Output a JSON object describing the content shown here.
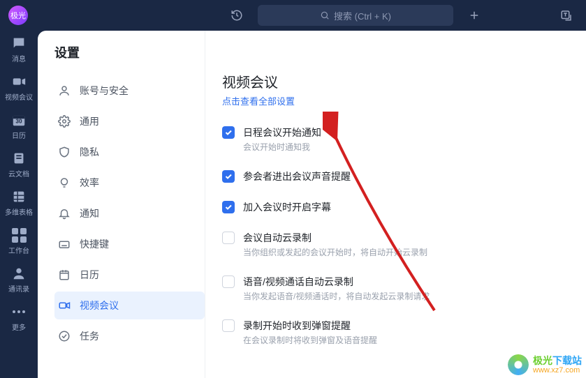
{
  "topbar": {
    "avatar_text": "极光",
    "search_placeholder": "搜索 (Ctrl + K)"
  },
  "leftnav": {
    "items": [
      {
        "id": "messages",
        "label": "消息"
      },
      {
        "id": "video",
        "label": "视频会议"
      },
      {
        "id": "calendar",
        "label": "日历"
      },
      {
        "id": "docs",
        "label": "云文档"
      },
      {
        "id": "sheets",
        "label": "多维表格"
      },
      {
        "id": "workbench",
        "label": "工作台"
      },
      {
        "id": "contacts",
        "label": "通讯录"
      },
      {
        "id": "more",
        "label": "更多"
      }
    ]
  },
  "settings": {
    "title": "设置",
    "items": [
      {
        "id": "account",
        "label": "账号与安全"
      },
      {
        "id": "general",
        "label": "通用"
      },
      {
        "id": "privacy",
        "label": "隐私"
      },
      {
        "id": "efficiency",
        "label": "效率"
      },
      {
        "id": "notify",
        "label": "通知"
      },
      {
        "id": "shortcut",
        "label": "快捷键"
      },
      {
        "id": "calendar",
        "label": "日历"
      },
      {
        "id": "videoconf",
        "label": "视频会议"
      },
      {
        "id": "tasks",
        "label": "任务"
      }
    ],
    "active_id": "videoconf"
  },
  "content": {
    "section_title": "视频会议",
    "section_link": "点击查看全部设置",
    "options": [
      {
        "checked": true,
        "title": "日程会议开始通知",
        "desc": "会议开始时通知我"
      },
      {
        "checked": true,
        "title": "参会者进出会议声音提醒",
        "desc": ""
      },
      {
        "checked": true,
        "title": "加入会议时开启字幕",
        "desc": ""
      },
      {
        "checked": false,
        "title": "会议自动云录制",
        "desc": "当你组织或发起的会议开始时，将自动开始云录制"
      },
      {
        "checked": false,
        "title": "语音/视频通话自动云录制",
        "desc": "当你发起语音/视频通话时，将自动发起云录制请求"
      },
      {
        "checked": false,
        "title": "录制开始时收到弹窗提醒",
        "desc": "在会议录制时将收到弹窗及语音提醒"
      }
    ]
  },
  "watermark": {
    "brand_prefix": "极光",
    "brand_suffix": "下载站",
    "url": "www.xz7.com"
  },
  "colors": {
    "accent": "#2f6fed",
    "nav_bg": "#1a2844",
    "arrow": "#d32020"
  }
}
